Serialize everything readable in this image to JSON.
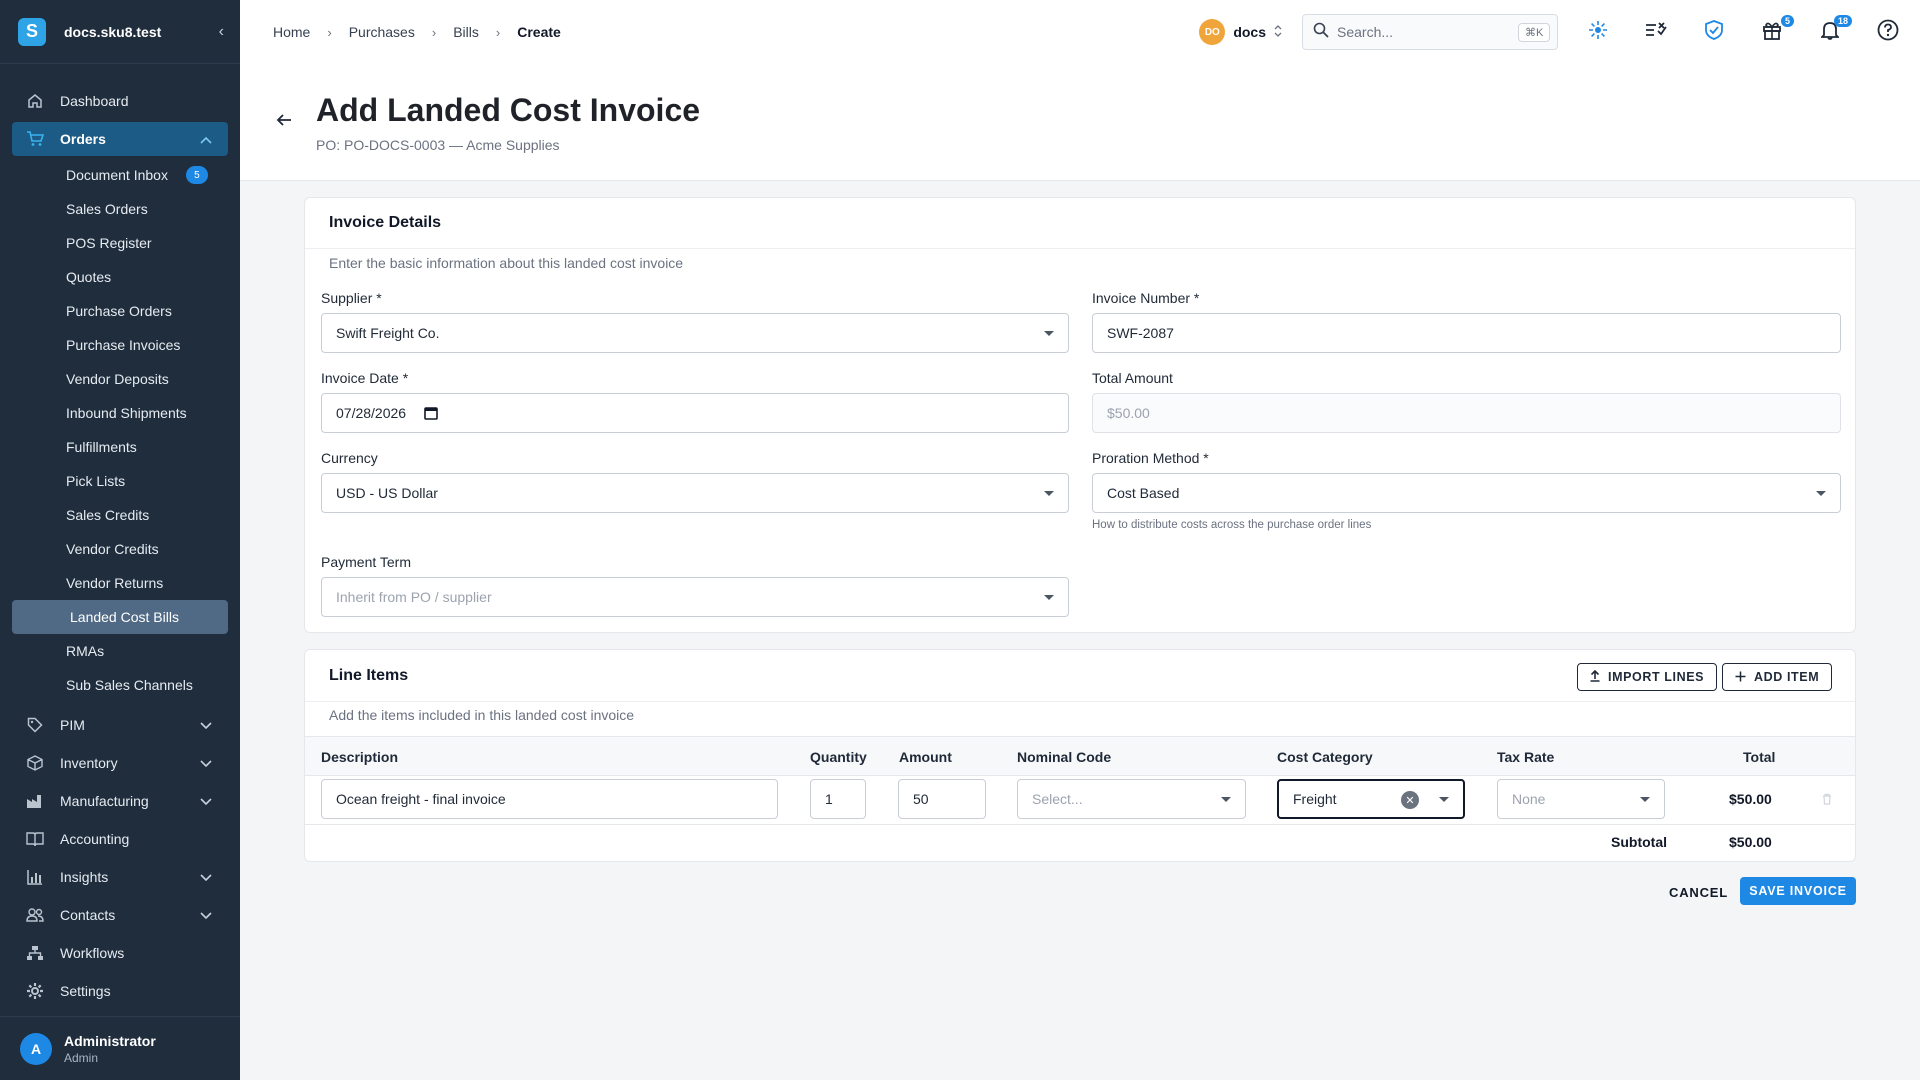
{
  "app": {
    "name": "docs.sku8.test",
    "logo_letter": "S"
  },
  "sidebar": {
    "items_top": [
      {
        "label": "Dashboard",
        "icon": "home-icon"
      }
    ],
    "orders": {
      "label": "Orders",
      "icon": "cart-icon",
      "children": [
        {
          "label": "Document Inbox",
          "badge": "5"
        },
        {
          "label": "Sales Orders"
        },
        {
          "label": "POS Register"
        },
        {
          "label": "Quotes"
        },
        {
          "label": "Purchase Orders"
        },
        {
          "label": "Purchase Invoices"
        },
        {
          "label": "Vendor Deposits"
        },
        {
          "label": "Inbound Shipments"
        },
        {
          "label": "Fulfillments"
        },
        {
          "label": "Pick Lists"
        },
        {
          "label": "Sales Credits"
        },
        {
          "label": "Vendor Credits"
        },
        {
          "label": "Vendor Returns"
        },
        {
          "label": "Landed Cost Bills",
          "selected": true
        },
        {
          "label": "RMAs"
        },
        {
          "label": "Sub Sales Channels"
        }
      ]
    },
    "items_bottom": [
      {
        "label": "PIM",
        "icon": "tag-icon",
        "expandable": true
      },
      {
        "label": "Inventory",
        "icon": "box-icon",
        "expandable": true
      },
      {
        "label": "Manufacturing",
        "icon": "factory-icon",
        "expandable": true
      },
      {
        "label": "Accounting",
        "icon": "book-icon",
        "expandable": false
      },
      {
        "label": "Insights",
        "icon": "bar-chart-icon",
        "expandable": true
      },
      {
        "label": "Contacts",
        "icon": "people-icon",
        "expandable": true
      },
      {
        "label": "Workflows",
        "icon": "workflow-icon",
        "expandable": false
      }
    ],
    "settings_label": "Settings",
    "user": {
      "initial": "A",
      "name": "Administrator",
      "role": "Admin"
    }
  },
  "topbar": {
    "breadcrumbs": [
      "Home",
      "Purchases",
      "Bills",
      "Create"
    ],
    "account": {
      "initials": "DO",
      "name": "docs"
    },
    "search": {
      "placeholder": "Search...",
      "shortcut": "⌘K"
    },
    "gift_badge": "5",
    "notif_badge": "18"
  },
  "page": {
    "title": "Add Landed Cost Invoice",
    "subtitle": "PO: PO-DOCS-0003 — Acme Supplies"
  },
  "invoice_details": {
    "title": "Invoice Details",
    "description": "Enter the basic information about this landed cost invoice",
    "supplier": {
      "label": "Supplier *",
      "value": "Swift Freight Co."
    },
    "invoice_number": {
      "label": "Invoice Number *",
      "value": "SWF-2087"
    },
    "invoice_date": {
      "label": "Invoice Date *",
      "value": "07/28/2026"
    },
    "total_amount": {
      "label": "Total Amount",
      "value": "$50.00"
    },
    "currency": {
      "label": "Currency",
      "value": "USD - US Dollar"
    },
    "proration": {
      "label": "Proration Method *",
      "value": "Cost Based",
      "helper": "How to distribute costs across the purchase order lines"
    },
    "payment_term": {
      "label": "Payment Term",
      "placeholder": "Inherit from PO / supplier"
    }
  },
  "line_items": {
    "title": "Line Items",
    "description": "Add the items included in this landed cost invoice",
    "import_label": "IMPORT LINES",
    "add_label": "ADD ITEM",
    "columns": [
      "Description",
      "Quantity",
      "Amount",
      "Nominal Code",
      "Cost Category",
      "Tax Rate",
      "Total"
    ],
    "rows": [
      {
        "description": "Ocean freight - final invoice",
        "quantity": "1",
        "amount": "50",
        "nominal_code": "Select...",
        "cost_category": "Freight",
        "tax_rate": "None",
        "total": "$50.00"
      }
    ],
    "subtotal_label": "Subtotal",
    "subtotal_value": "$50.00"
  },
  "actions": {
    "cancel": "CANCEL",
    "save": "SAVE INVOICE"
  },
  "colors": {
    "sidebar_bg": "#1f2d3d",
    "accent": "#1e88e5",
    "active_nav": "#1d5b87"
  }
}
